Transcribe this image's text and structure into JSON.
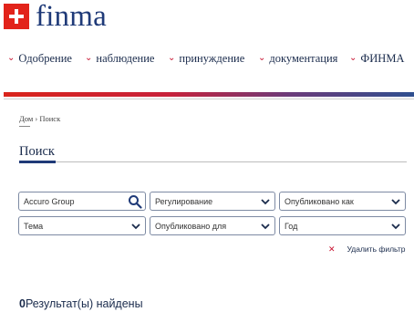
{
  "logo": {
    "text": "finma"
  },
  "nav": [
    {
      "label": "Одобрение"
    },
    {
      "label": "наблюдение"
    },
    {
      "label": "принуждение"
    },
    {
      "label": "документация"
    },
    {
      "label": "ФИНМА"
    }
  ],
  "breadcrumb": {
    "home": "Дом",
    "separator": "›",
    "current": "Поиск"
  },
  "page": {
    "title": "Поиск"
  },
  "filters": {
    "search_value": "Accuro Group",
    "regulation": "Регулирование",
    "published_as": "Опубликовано как",
    "topic": "Тема",
    "published_for": "Опубликовано для",
    "year": "Год"
  },
  "clear_filter": {
    "label": "Удалить фильтр"
  },
  "results": {
    "count": "0",
    "text": "Результат(ы) найдены"
  },
  "colors": {
    "brand_blue": "#1f3a78",
    "brand_red": "#c8102e"
  }
}
